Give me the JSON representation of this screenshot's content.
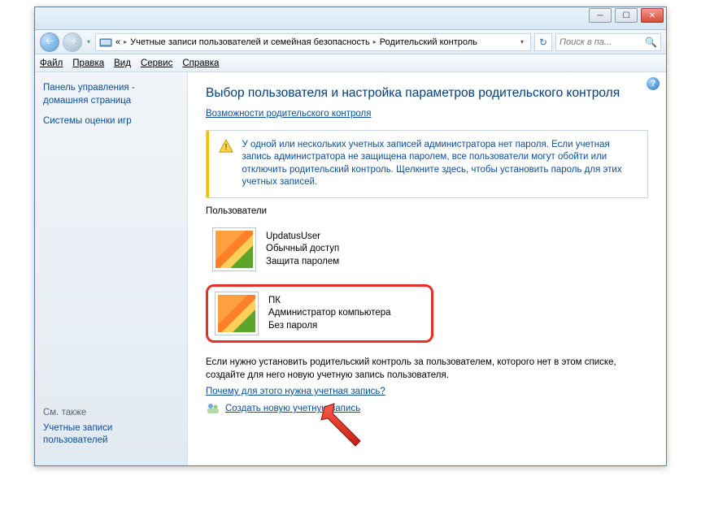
{
  "breadcrumb": {
    "prefix": "«",
    "item1": "Учетные записи пользователей и семейная безопасность",
    "item2": "Родительский контроль"
  },
  "search": {
    "placeholder": "Поиск в па..."
  },
  "menu": {
    "file": "Файл",
    "edit": "Правка",
    "view": "Вид",
    "tools": "Сервис",
    "help": "Справка"
  },
  "sidebar": {
    "link1": "Панель управления - домашняя страница",
    "link2": "Системы оценки игр",
    "see_also_label": "См. также",
    "see_also_link": "Учетные записи пользователей"
  },
  "content": {
    "title": "Выбор пользователя и настройка параметров родительского контроля",
    "caplink": "Возможности родительского контроля",
    "warning": "У одной или нескольких учетных записей администратора нет пароля. Если учетная запись администратора не защищена паролем, все пользователи могут обойти или отключить родительский контроль. Щелкните здесь, чтобы установить пароль для этих учетных записей.",
    "users_label": "Пользователи",
    "users": [
      {
        "name": "UpdatusUser",
        "role": "Обычный доступ",
        "prot": "Защита паролем"
      },
      {
        "name": "ПК",
        "role": "Администратор компьютера",
        "prot": "Без пароля"
      }
    ],
    "help_text": "Если нужно установить родительский контроль за пользователем, которого нет в этом списке, создайте для него новую учетную запись пользователя.",
    "why_link": "Почему для этого нужна учетная запись?",
    "create_link": "Создать новую учетную запись"
  }
}
